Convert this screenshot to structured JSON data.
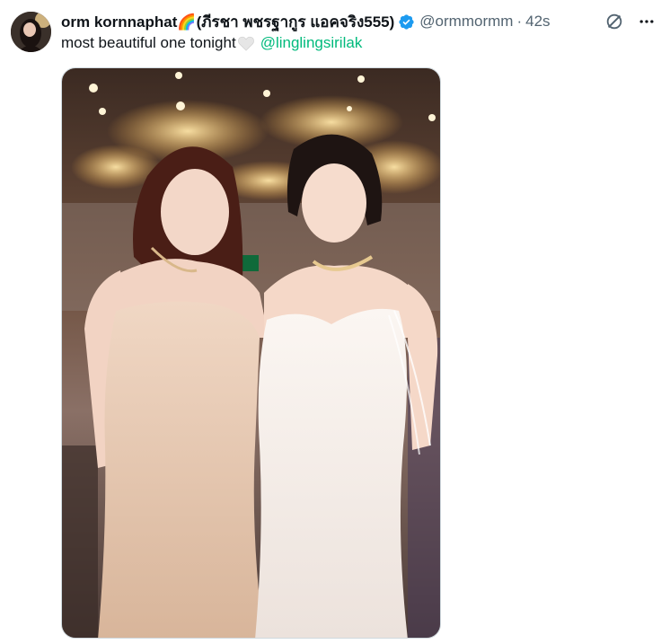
{
  "tweet": {
    "display_name": "orm kornnaphat",
    "rainbow_emoji": "🌈",
    "display_name_rest": "(ภีรชา พชรฐากูร แอคจริง555)",
    "handle": "@ormmormm",
    "separator": "·",
    "time": "42s",
    "text": "most beautiful one tonight",
    "mention": "@linglingsirilak"
  },
  "colors": {
    "verified": "#1d9bf0",
    "mention": "#00ba7c",
    "secondary_text": "#536471"
  },
  "icons": [
    "verified-badge-icon",
    "grok-icon",
    "more-options-icon",
    "white-heart-icon"
  ]
}
